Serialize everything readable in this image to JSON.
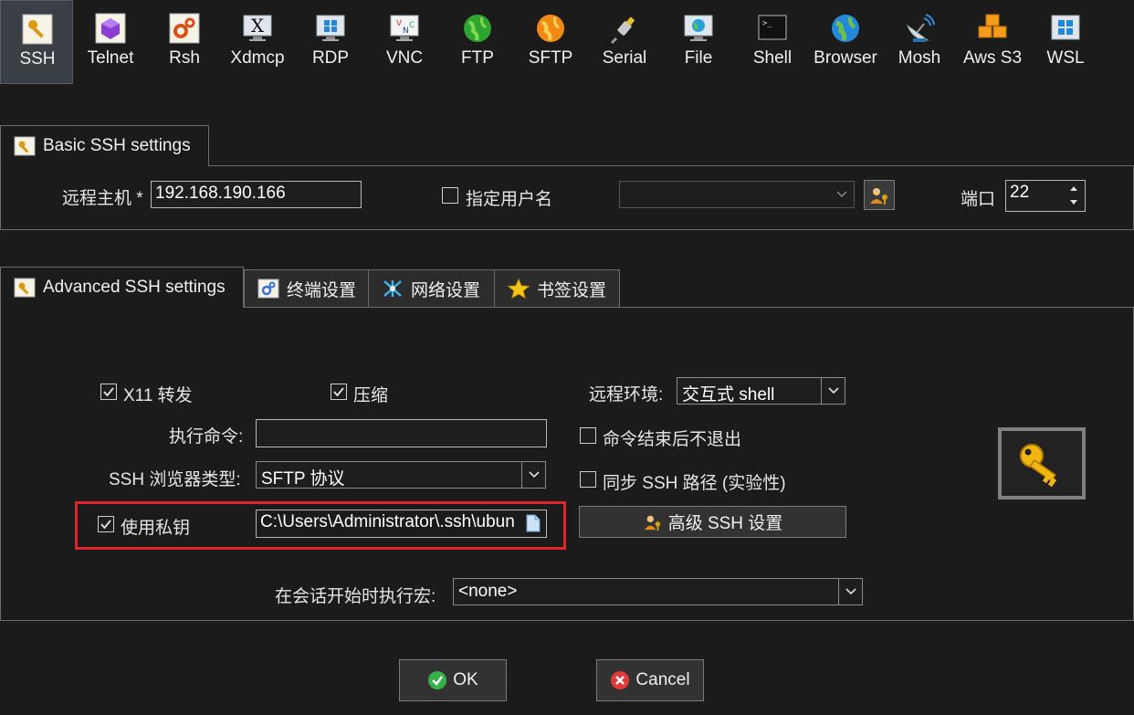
{
  "toolbar": {
    "items": [
      {
        "label": "SSH",
        "icon": "key-icon",
        "active": true
      },
      {
        "label": "Telnet",
        "icon": "purple-gem-icon"
      },
      {
        "label": "Rsh",
        "icon": "gears-icon"
      },
      {
        "label": "Xdmcp",
        "icon": "x-monitor-icon"
      },
      {
        "label": "RDP",
        "icon": "windows-monitor-icon"
      },
      {
        "label": "VNC",
        "icon": "vnc-monitor-icon"
      },
      {
        "label": "FTP",
        "icon": "green-globe-icon"
      },
      {
        "label": "SFTP",
        "icon": "orange-globe-icon"
      },
      {
        "label": "Serial",
        "icon": "serial-plug-icon"
      },
      {
        "label": "File",
        "icon": "file-monitor-icon"
      },
      {
        "label": "Shell",
        "icon": "shell-terminal-icon"
      },
      {
        "label": "Browser",
        "icon": "browser-globe-icon"
      },
      {
        "label": "Mosh",
        "icon": "satellite-dish-icon"
      },
      {
        "label": "Aws S3",
        "icon": "aws-cubes-icon"
      },
      {
        "label": "WSL",
        "icon": "windows-tile-icon"
      }
    ]
  },
  "basic": {
    "tab_label": "Basic SSH settings",
    "remote_host_label": "远程主机 *",
    "remote_host_value": "192.168.190.166",
    "specify_user_label": "指定用户名",
    "specify_user_checked": false,
    "username_value": "",
    "port_label": "端口",
    "port_value": "22"
  },
  "advanced": {
    "tabs": [
      {
        "label": "Advanced SSH settings",
        "icon": "key-icon",
        "active": true
      },
      {
        "label": "终端设置",
        "icon": "terminal-settings-icon"
      },
      {
        "label": "网络设置",
        "icon": "network-icon"
      },
      {
        "label": "书签设置",
        "icon": "star-icon"
      }
    ],
    "x11_label": "X11 转发",
    "x11_checked": true,
    "compress_label": "压缩",
    "compress_checked": true,
    "remote_env_label": "远程环境:",
    "remote_env_value": "交互式 shell",
    "exec_cmd_label": "执行命令:",
    "exec_cmd_value": "",
    "no_exit_label": "命令结束后不退出",
    "no_exit_checked": false,
    "browser_type_label": "SSH 浏览器类型:",
    "browser_type_value": "SFTP 协议",
    "sync_path_label": "同步 SSH 路径 (实验性)",
    "sync_path_checked": false,
    "private_key_label": "使用私钥",
    "private_key_checked": true,
    "private_key_value": "C:\\Users\\Administrator\\.ssh\\ubun",
    "advanced_ssh_button": "高级 SSH 设置",
    "macro_label": "在会话开始时执行宏:",
    "macro_value": "<none>"
  },
  "footer": {
    "ok_label": "OK",
    "cancel_label": "Cancel"
  },
  "colors": {
    "highlight": "#e0252b",
    "background": "#1b1b1b"
  }
}
